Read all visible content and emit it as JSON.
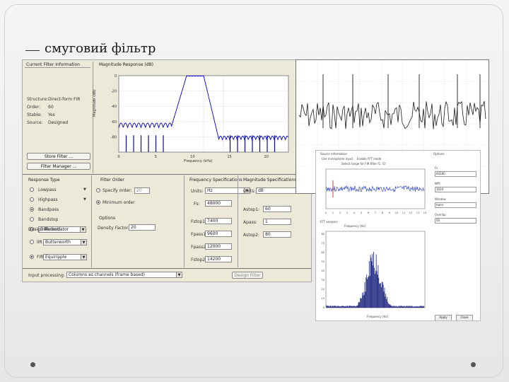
{
  "slide": {
    "title": "смуговий фільтр"
  },
  "fdatool": {
    "current_filter_info": {
      "title": "Current Filter Information",
      "rows": [
        {
          "key": "Structure:",
          "value": "Direct-form FIR"
        },
        {
          "key": "Order:",
          "value": "60"
        },
        {
          "key": "Stable:",
          "value": "Yes"
        },
        {
          "key": "Source:",
          "value": "Designed"
        }
      ],
      "store_button": "Store Filter ...",
      "manager_button": "Filter Manager ..."
    },
    "plot": {
      "title": "Magnitude Response (dB)",
      "ylabel": "Magnitude (dB)",
      "xlabel": "Frequency (kHz)",
      "y_ticks": [
        "0",
        "-20",
        "-40",
        "-60",
        "-80"
      ],
      "x_ticks": [
        "0",
        "5",
        "10",
        "15",
        "20"
      ]
    },
    "response_type": {
      "title": "Response Type",
      "options": [
        "Lowpass",
        "Highpass",
        "Bandpass",
        "Bandstop",
        "Differentiator"
      ],
      "selected": "Bandpass"
    },
    "design_method": {
      "title": "Design Method",
      "iir_label": "IIR",
      "iir_value": "Butterworth",
      "fir_label": "FIR",
      "fir_value": "Equiripple",
      "selected": "FIR"
    },
    "filter_order": {
      "title": "Filter Order",
      "specify_label": "Specify order:",
      "specify_value": "20",
      "minimum_label": "Minimum order"
    },
    "options": {
      "title": "Options",
      "density_label": "Density Factor:",
      "density_value": "20"
    },
    "freq_spec": {
      "title": "Frequency Specifications",
      "units_label": "Units:",
      "units_value": "Hz",
      "fs_label": "Fs:",
      "fs_value": "48000",
      "rows": [
        {
          "label": "Fstop1:",
          "value": "7400"
        },
        {
          "label": "Fpass1:",
          "value": "9600"
        },
        {
          "label": "Fpass2:",
          "value": "12000"
        },
        {
          "label": "Fstop2:",
          "value": "14200"
        }
      ]
    },
    "mag_spec": {
      "title": "Magnitude Specifications",
      "units_label": "Units:",
      "units_value": "dB",
      "rows": [
        {
          "label": "Astop1:",
          "value": "60"
        },
        {
          "label": "Apass:",
          "value": "1"
        },
        {
          "label": "Astop2:",
          "value": "80"
        }
      ]
    },
    "input_processing": {
      "label": "Input processing:",
      "value": "Columns as channels (frame based)"
    },
    "design_button": "Design Filter"
  },
  "analyzer": {
    "source_title": "Source information",
    "source_check1": "Use microphone input",
    "source_check2": "Enable FFT mode",
    "select_text": "Select range for FIR filter  f1:  f2:",
    "fft_title": "FFT analysis",
    "fft_subtitle": "Frequency (Hz)",
    "spectrum_label": "Frequency (Hz)",
    "right_panel_title": "Options",
    "right_rows": [
      {
        "label": "Fs",
        "value": "44100"
      },
      {
        "label": "Nfft",
        "value": "1024"
      },
      {
        "label": "Window",
        "value": "hann"
      },
      {
        "label": "Overlap",
        "value": "50"
      }
    ],
    "ok_button": "Apply",
    "close_button": "Close"
  },
  "colors": {
    "stem": "#0b0b9a",
    "response": "#0000cc",
    "signal": "#1c1c1c",
    "filtered_signal": "#2a3fbf",
    "spectrum": "#1a237e"
  }
}
